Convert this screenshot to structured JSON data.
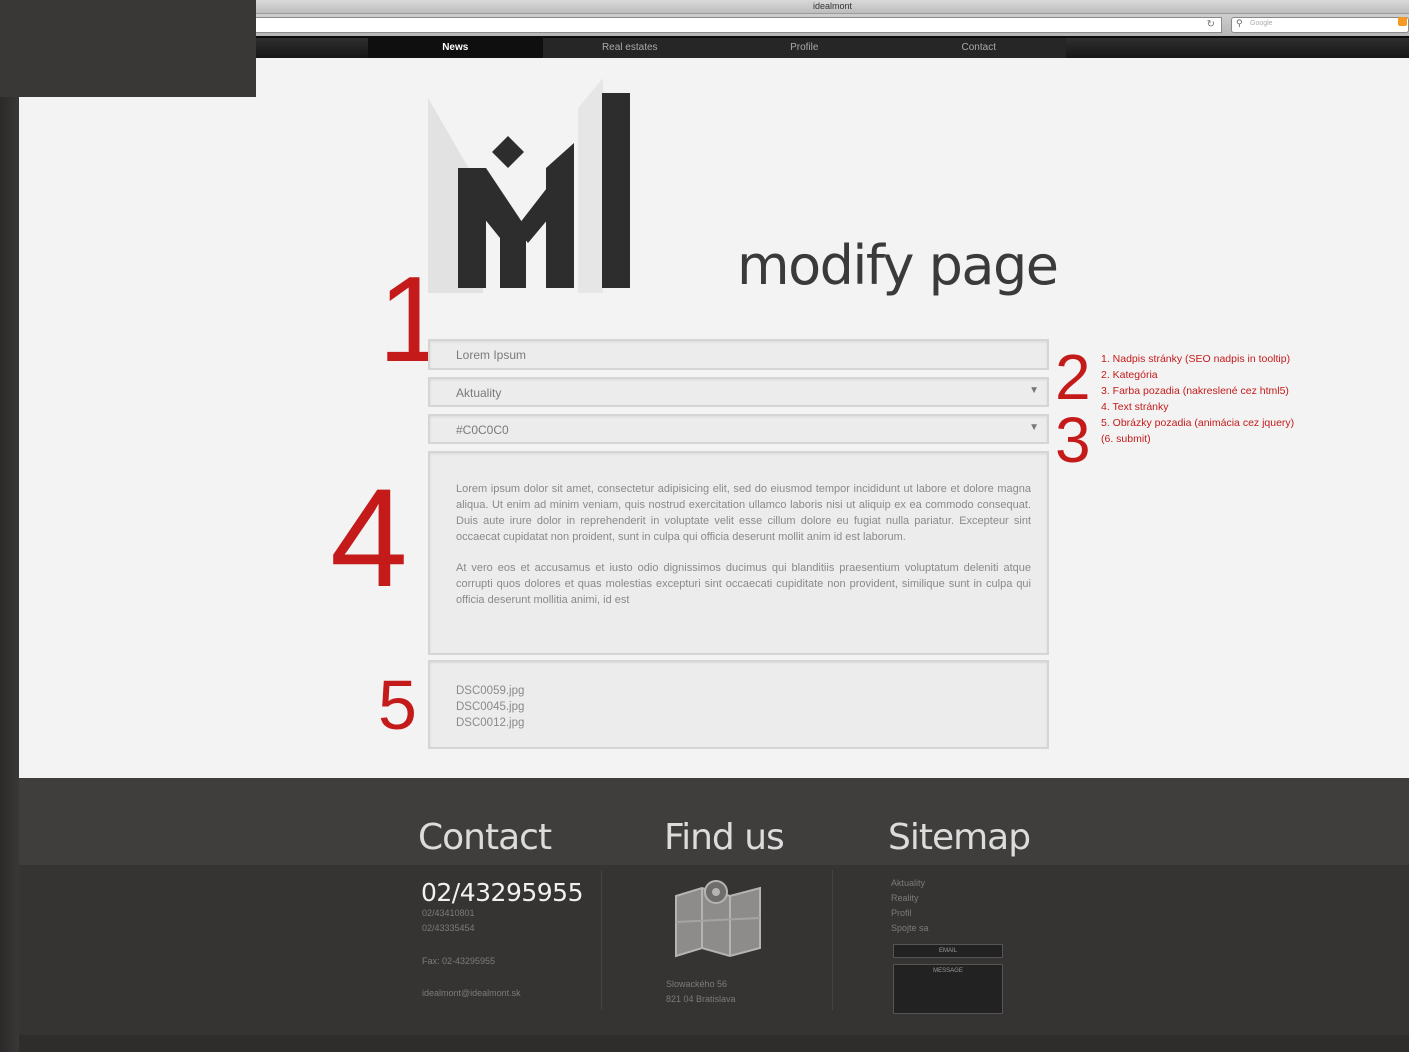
{
  "browser": {
    "window_title": "idealmont",
    "search_placeholder": "Google"
  },
  "nav": {
    "items": [
      {
        "label": "News",
        "active": true
      },
      {
        "label": "Real estates",
        "active": false
      },
      {
        "label": "Profile",
        "active": false
      },
      {
        "label": "Contact",
        "active": false
      }
    ]
  },
  "page": {
    "title": "modify page",
    "step_numbers": [
      "1",
      "2",
      "3",
      "4",
      "5"
    ]
  },
  "form": {
    "page_title_value": "Lorem Ipsum",
    "category_value": "Aktuality",
    "background_color_value": "#C0C0C0",
    "text_paragraphs": [
      "Lorem ipsum dolor sit amet, consectetur adipisicing elit, sed do eiusmod tempor incididunt ut labore et dolore magna aliqua. Ut enim ad minim veniam, quis nostrud exercitation ullamco laboris nisi ut aliquip ex ea commodo consequat. Duis aute irure dolor in reprehenderit in voluptate velit esse cillum dolore eu fugiat nulla pariatur. Excepteur sint occaecat cupidatat non proident, sunt in culpa qui officia deserunt mollit anim id est laborum.",
      "At vero eos et accusamus et iusto odio dignissimos ducimus qui blanditiis praesentium voluptatum deleniti atque corrupti quos dolores et quas molestias excepturi sint occaecati cupiditate non provident, similique sunt in culpa qui officia deserunt mollitia animi, id est"
    ],
    "images": [
      "DSC0059.jpg",
      "DSC0045.jpg",
      "DSC0012.jpg"
    ]
  },
  "legend": {
    "items": [
      "1. Nadpis stránky (SEO nadpis in tooltip)",
      "2. Kategória",
      "3. Farba pozadia (nakreslené cez html5)",
      "4. Text stránky",
      "5. Obrázky pozadia (animácia cez jquery)",
      "(6. submit)"
    ]
  },
  "footer": {
    "contact_heading": "Contact",
    "findus_heading": "Find us",
    "sitemap_heading": "Sitemap",
    "phone_main": "02/43295955",
    "phones_alt": [
      "02/43410801",
      "02/43335454"
    ],
    "fax": "Fax: 02-43295955",
    "email": "idealmont@idealmont.sk",
    "address": [
      "Slowackého 56",
      "821 04 Bratislava"
    ],
    "sitemap_links": [
      "Aktuality",
      "Reality",
      "Profil",
      "Spojte sa"
    ],
    "form_email_label": "EMAIL",
    "form_message_label": "MESSAGE"
  },
  "colors": {
    "accent_red": "#c41a1a",
    "nav_bg": "#1a1a1a",
    "footer_bg": "#3f3e3d",
    "page_bg": "#f3f3f3"
  }
}
